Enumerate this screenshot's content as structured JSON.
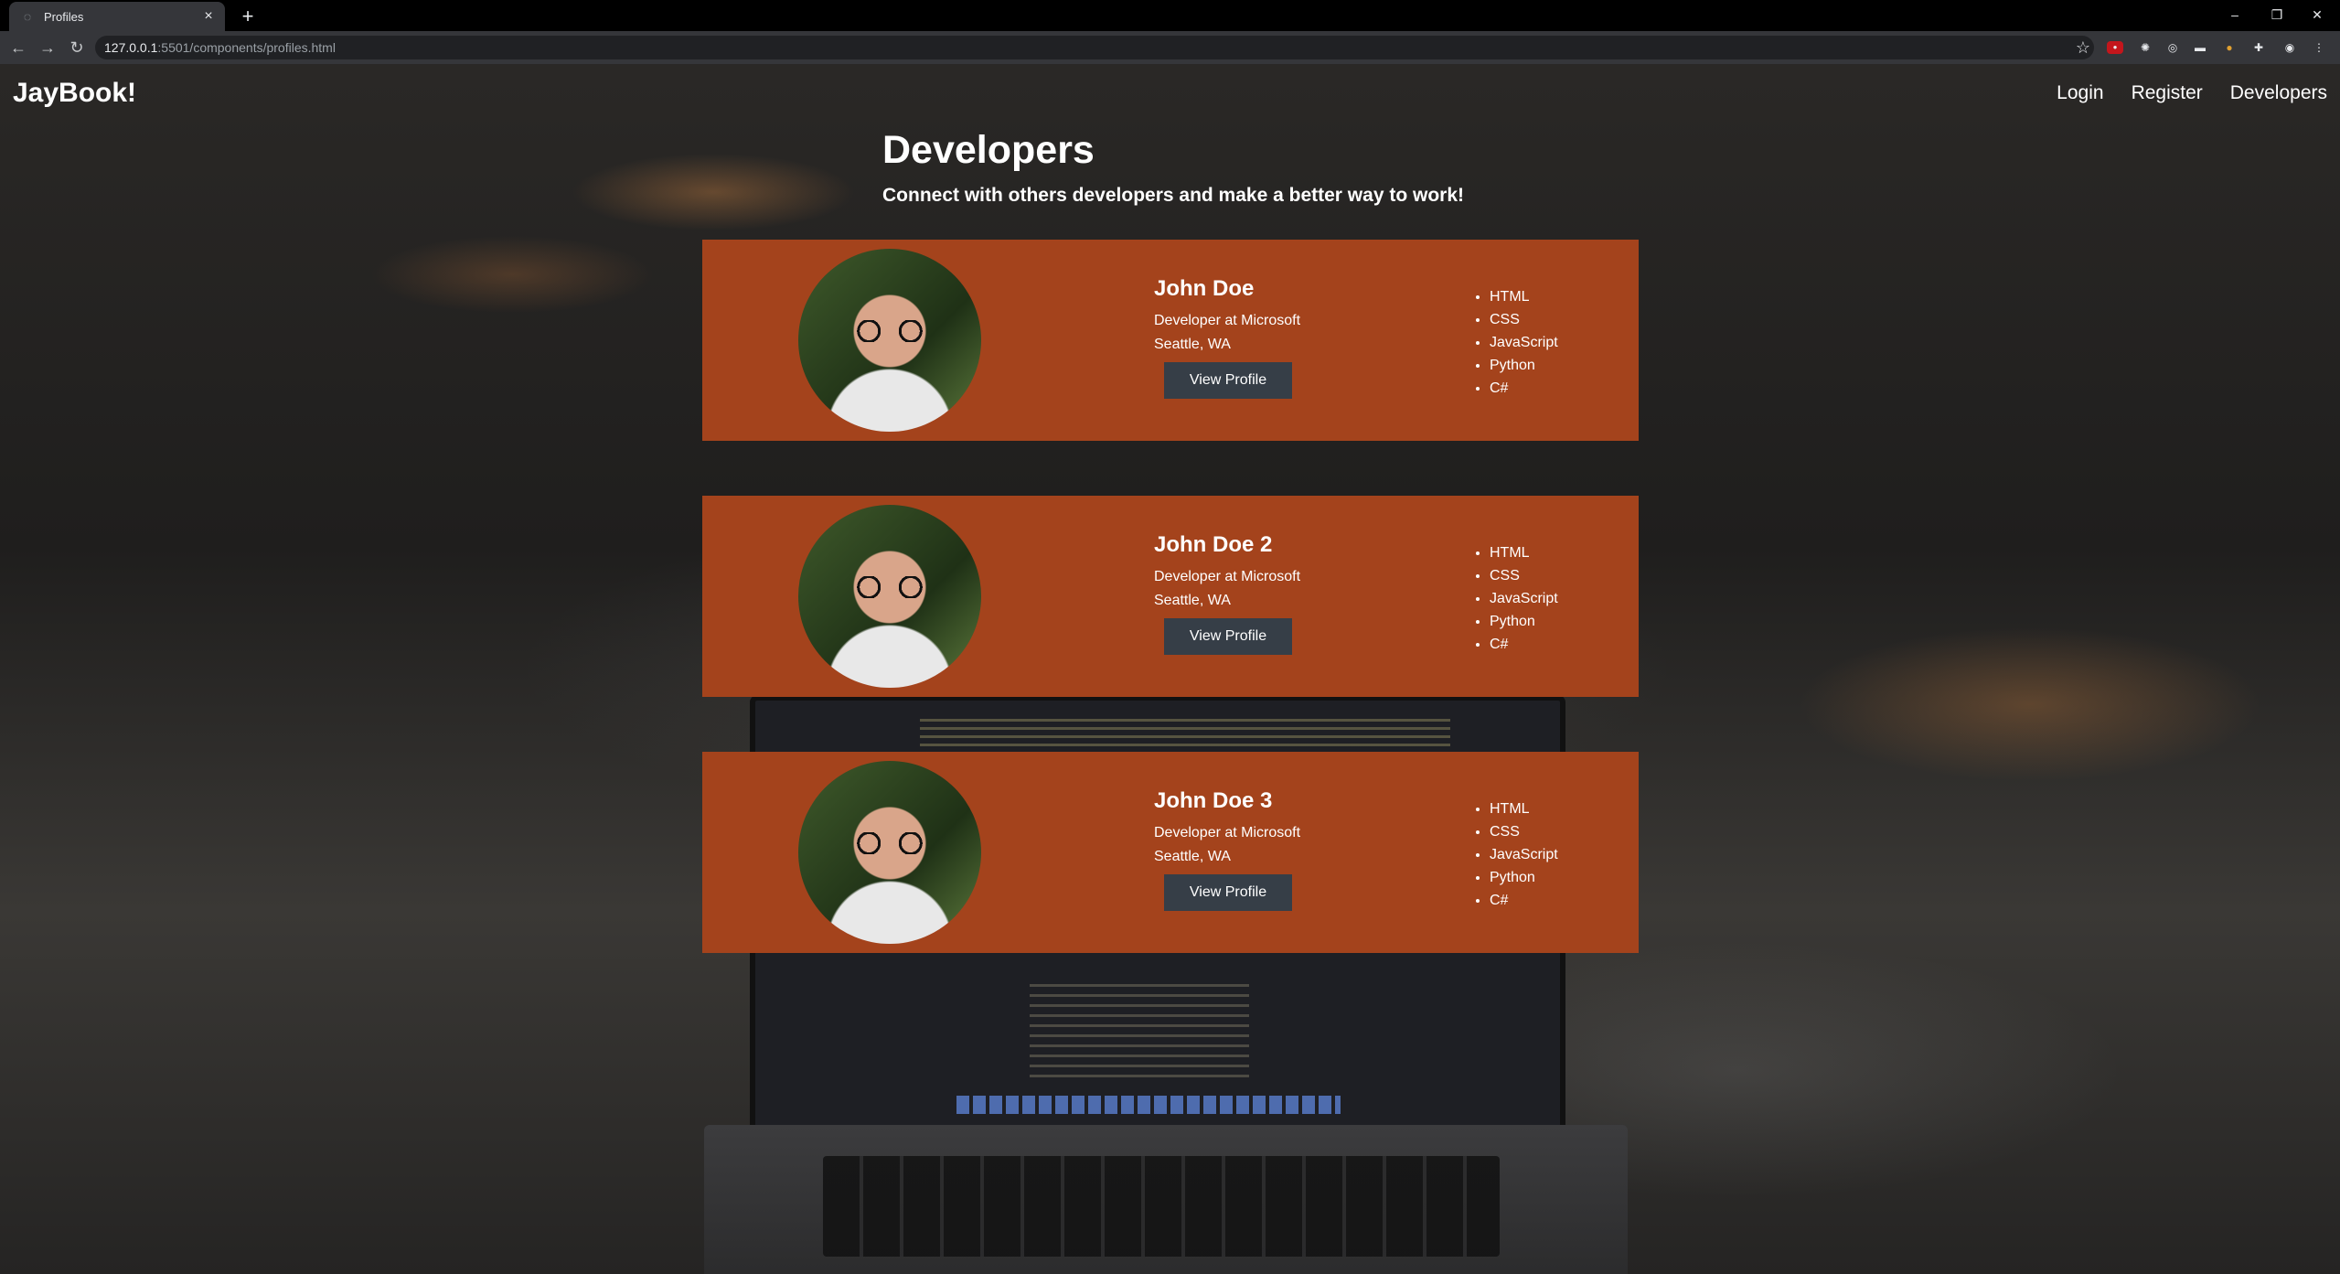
{
  "browser": {
    "tab_title": "Profiles",
    "url_host": "127.0.0.1",
    "url_rest": ":5501/components/profiles.html"
  },
  "site": {
    "brand": "JayBook!",
    "nav": [
      "Login",
      "Register",
      "Developers"
    ]
  },
  "page": {
    "title": "Developers",
    "lead": "Connect with others developers and make a better way to work!"
  },
  "profiles": [
    {
      "name": "John Doe",
      "job": "Developer at Microsoft",
      "location": "Seattle, WA",
      "button": "View Profile",
      "skills": [
        "HTML",
        "CSS",
        "JavaScript",
        "Python",
        "C#"
      ]
    },
    {
      "name": "John Doe 2",
      "job": "Developer at Microsoft",
      "location": "Seattle, WA",
      "button": "View Profile",
      "skills": [
        "HTML",
        "CSS",
        "JavaScript",
        "Python",
        "C#"
      ]
    },
    {
      "name": "John Doe 3",
      "job": "Developer at Microsoft",
      "location": "Seattle, WA",
      "button": "View Profile",
      "skills": [
        "HTML",
        "CSS",
        "JavaScript",
        "Python",
        "C#"
      ]
    }
  ],
  "colors": {
    "card": "#a4431c",
    "button": "#363e47"
  }
}
